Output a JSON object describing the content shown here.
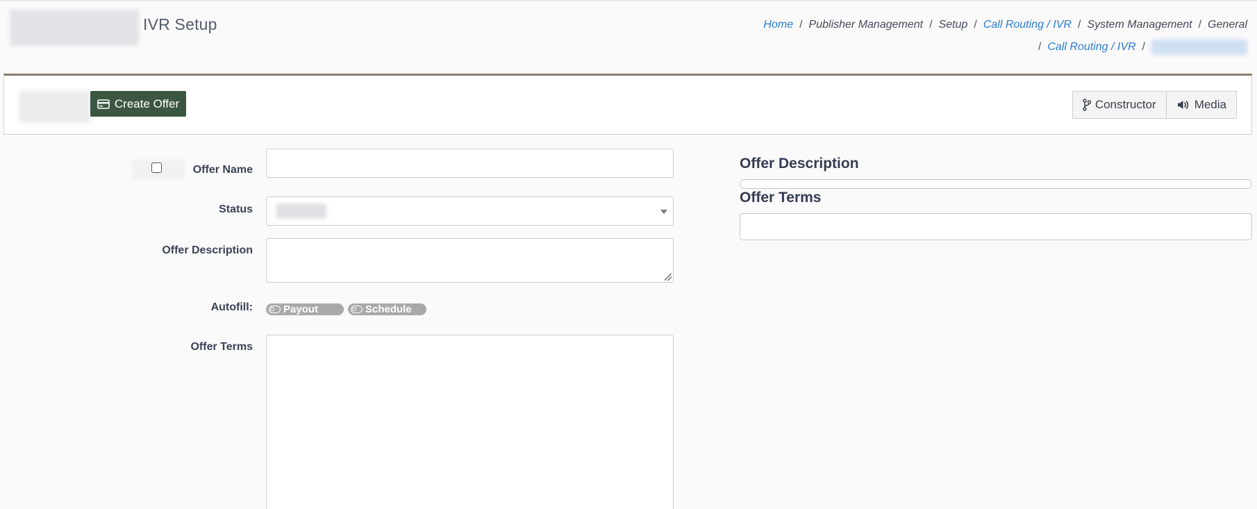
{
  "page": {
    "title": "IVR Setup"
  },
  "breadcrumb": {
    "items": [
      {
        "label": "Home",
        "link": true
      },
      {
        "label": "Publisher Management",
        "link": false
      },
      {
        "label": "Setup",
        "link": false
      },
      {
        "label": "Call Routing / IVR",
        "link": true
      },
      {
        "label": "System Management",
        "link": false
      },
      {
        "label": "General",
        "link": false
      },
      {
        "label": "Call Routing / IVR",
        "link": true
      }
    ],
    "separator": "/"
  },
  "toolbar": {
    "create_offer_label": "Create Offer",
    "constructor_label": "Constructor",
    "media_label": "Media"
  },
  "form": {
    "offer_name_label": "Offer Name",
    "offer_name_value": "",
    "status_label": "Status",
    "offer_description_label": "Offer Description",
    "offer_description_value": "",
    "autofill_label": "Autofill:",
    "autofill_payout_label": "Payout",
    "autofill_schedule_label": "Schedule",
    "offer_terms_label": "Offer Terms",
    "offer_terms_value": ""
  },
  "preview": {
    "description_title": "Offer Description",
    "terms_title": "Offer Terms"
  },
  "colors": {
    "create_offer_bg": "#3b5742",
    "link": "#2a7bd1",
    "toolbar_accent": "#8a7a6c",
    "toggle_off": "#a9a9ab"
  }
}
